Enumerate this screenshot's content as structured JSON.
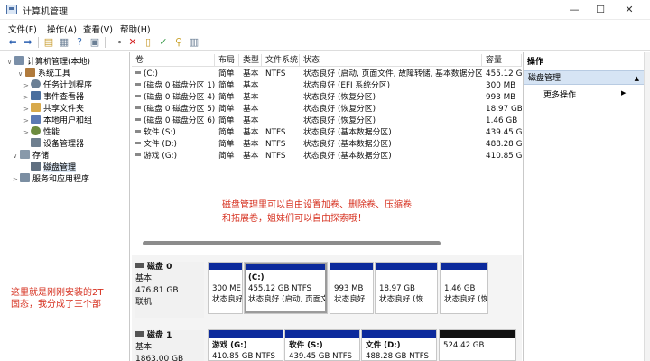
{
  "window": {
    "title": "计算机管理",
    "minimize": "—",
    "maximize": "☐",
    "close": "✕"
  },
  "menu": [
    "文件(F)",
    "操作(A)",
    "查看(V)",
    "帮助(H)"
  ],
  "tree": {
    "items": [
      {
        "label": "计算机管理(本地)",
        "caret": "∨",
        "icon_color": "#7a8fa8"
      },
      {
        "label": "系统工具",
        "caret": "∨",
        "icon_color": "#b07a3c"
      },
      {
        "label": "任务计划程序",
        "caret": ">",
        "icon_color": "#6a7f95"
      },
      {
        "label": "事件查看器",
        "caret": ">",
        "icon_color": "#4b6f9e"
      },
      {
        "label": "共享文件夹",
        "caret": ">",
        "icon_color": "#d8a94a"
      },
      {
        "label": "本地用户和组",
        "caret": ">",
        "icon_color": "#5b79b3"
      },
      {
        "label": "性能",
        "caret": ">",
        "icon_color": "#6c8b3f"
      },
      {
        "label": "设备管理器",
        "caret": "",
        "icon_color": "#6e7f8f"
      },
      {
        "label": "存储",
        "caret": "∨",
        "icon_color": "#8899aa"
      },
      {
        "label": "磁盘管理",
        "caret": "",
        "icon_color": "#5f6f80"
      },
      {
        "label": "服务和应用程序",
        "caret": ">",
        "icon_color": "#7b8ea2"
      }
    ],
    "annotation": "这里就是刚刚安装的2T\n固态，我分成了三个部"
  },
  "list": {
    "columns": [
      "卷",
      "布局",
      "类型",
      "文件系统",
      "状态",
      "容量"
    ],
    "rows": [
      [
        "(C:)",
        "简单",
        "基本",
        "NTFS",
        "状态良好 (启动, 页面文件, 故障转储, 基本数据分区)",
        "455.12 GB"
      ],
      [
        "(磁盘 0 磁盘分区 1)",
        "简单",
        "基本",
        "",
        "状态良好 (EFI 系统分区)",
        "300 MB"
      ],
      [
        "(磁盘 0 磁盘分区 4)",
        "简单",
        "基本",
        "",
        "状态良好 (恢复分区)",
        "993 MB"
      ],
      [
        "(磁盘 0 磁盘分区 5)",
        "简单",
        "基本",
        "",
        "状态良好 (恢复分区)",
        "18.97 GB"
      ],
      [
        "(磁盘 0 磁盘分区 6)",
        "简单",
        "基本",
        "",
        "状态良好 (恢复分区)",
        "1.46 GB"
      ],
      [
        "软件 (S:)",
        "简单",
        "基本",
        "NTFS",
        "状态良好 (基本数据分区)",
        "439.45 GB"
      ],
      [
        "文件 (D:)",
        "简单",
        "基本",
        "NTFS",
        "状态良好 (基本数据分区)",
        "488.28 GB"
      ],
      [
        "游戏 (G:)",
        "简单",
        "基本",
        "NTFS",
        "状态良好 (基本数据分区)",
        "410.85 GB"
      ]
    ],
    "annotation": "磁盘管理里可以自由设置加卷、删除卷、压缩卷\n和拓展卷，姐妹们可以自由探索哦！"
  },
  "disks": [
    {
      "name": "磁盘 0",
      "type": "基本",
      "size": "476.81 GB",
      "status": "联机",
      "partitions": [
        {
          "name": "",
          "line1": "300 ME",
          "line2": "状态良好"
        },
        {
          "name": "(C:)",
          "line1": "455.12 GB NTFS",
          "line2": "状态良好 (启动, 页面文"
        },
        {
          "name": "",
          "line1": "993 MB",
          "line2": "状态良好"
        },
        {
          "name": "",
          "line1": "18.97 GB",
          "line2": "状态良好 (恢"
        },
        {
          "name": "",
          "line1": "1.46 GB",
          "line2": "状态良好 (恢"
        }
      ]
    },
    {
      "name": "磁盘 1",
      "type": "基本",
      "size": "1863.00 GB",
      "status": "",
      "partitions": [
        {
          "name": "游戏 (G:)",
          "line1": "410.85 GB NTFS",
          "line2": ""
        },
        {
          "name": "软件 (S:)",
          "line1": "439.45 GB NTFS",
          "line2": ""
        },
        {
          "name": "文件 (D:)",
          "line1": "488.28 GB NTFS",
          "line2": ""
        },
        {
          "name": "",
          "line1": "524.42 GB",
          "line2": ""
        }
      ]
    }
  ],
  "actions": {
    "title": "操作",
    "section": "磁盘管理",
    "more": "更多操作",
    "section_arrow": "▲",
    "more_arrow": "▶"
  }
}
